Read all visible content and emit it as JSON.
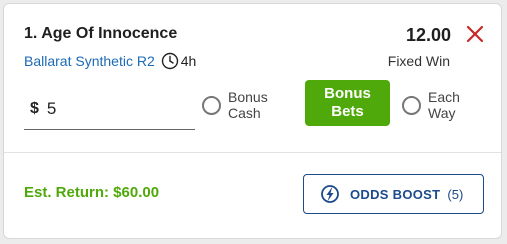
{
  "selection": {
    "name": "1. Age Of Innocence",
    "odds": "12.00",
    "race": "Ballarat Synthetic R2",
    "time_to_jump": "4h",
    "bet_type": "Fixed Win"
  },
  "stake": {
    "currency": "$",
    "value": "5"
  },
  "options": {
    "bonus_cash_line1": "Bonus",
    "bonus_cash_line2": "Cash",
    "bonus_bets_line1": "Bonus",
    "bonus_bets_line2": "Bets",
    "each_way_line1": "Each",
    "each_way_line2": "Way"
  },
  "footer": {
    "est_return": "Est. Return: $60.00",
    "odds_boost_label": "ODDS BOOST",
    "odds_boost_count": "(5)"
  },
  "icons": {
    "remove": "close-icon",
    "clock": "clock-icon",
    "boost": "odds-boost-icon"
  },
  "colors": {
    "accent_green": "#4fa90a",
    "link_blue": "#1d6ab6",
    "boost_navy": "#1d4a8c",
    "remove_red": "#c62828"
  }
}
